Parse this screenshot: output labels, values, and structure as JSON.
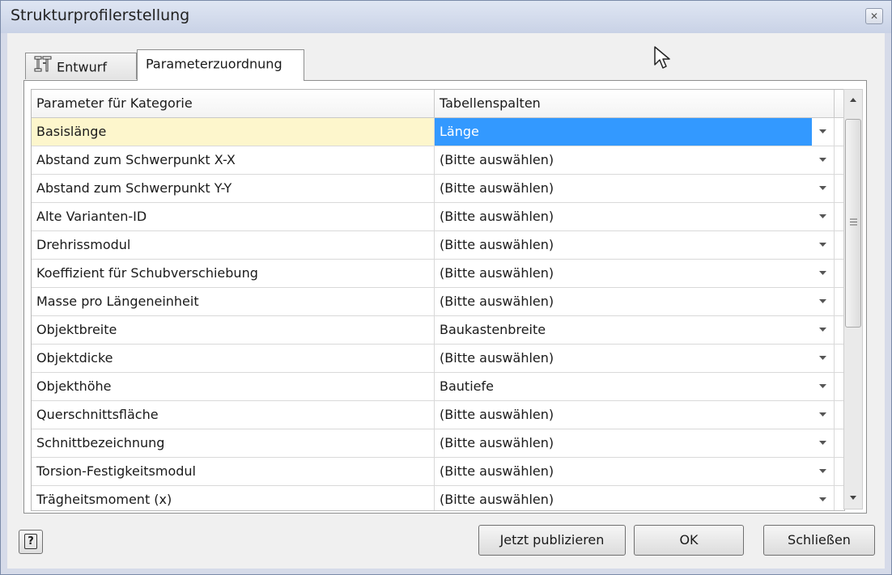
{
  "window": {
    "title": "Strukturprofilerstellung",
    "close_glyph": "✕"
  },
  "tabs": [
    {
      "label": "Entwurf",
      "icon": "structure-profile-icon",
      "active": false
    },
    {
      "label": "Parameterzuordnung",
      "active": true
    }
  ],
  "table": {
    "headers": [
      "Parameter für Kategorie",
      "Tabellenspalten"
    ],
    "rows": [
      {
        "parameter": "Basislänge",
        "column": "Länge",
        "selected": true
      },
      {
        "parameter": "Abstand zum Schwerpunkt X-X",
        "column": "(Bitte auswählen)"
      },
      {
        "parameter": "Abstand zum Schwerpunkt Y-Y",
        "column": "(Bitte auswählen)"
      },
      {
        "parameter": "Alte Varianten-ID",
        "column": "(Bitte auswählen)"
      },
      {
        "parameter": "Drehrissmodul",
        "column": "(Bitte auswählen)"
      },
      {
        "parameter": "Koeffizient für Schubverschiebung",
        "column": "(Bitte auswählen)"
      },
      {
        "parameter": "Masse pro Längeneinheit",
        "column": "(Bitte auswählen)"
      },
      {
        "parameter": "Objektbreite",
        "column": "Baukastenbreite"
      },
      {
        "parameter": "Objektdicke",
        "column": "(Bitte auswählen)"
      },
      {
        "parameter": "Objekthöhe",
        "column": "Bautiefe"
      },
      {
        "parameter": "Querschnittsfläche",
        "column": "(Bitte auswählen)"
      },
      {
        "parameter": "Schnittbezeichnung",
        "column": "(Bitte auswählen)"
      },
      {
        "parameter": "Torsion-Festigkeitsmodul",
        "column": "(Bitte auswählen)"
      },
      {
        "parameter": "Trägheitsmoment (x)",
        "column": "(Bitte auswählen)"
      }
    ]
  },
  "buttons": {
    "help": "?",
    "publish": "Jetzt publizieren",
    "ok": "OK",
    "close": "Schließen"
  },
  "colors": {
    "selection": "#3399ff",
    "current_row": "#fdf6cc"
  }
}
